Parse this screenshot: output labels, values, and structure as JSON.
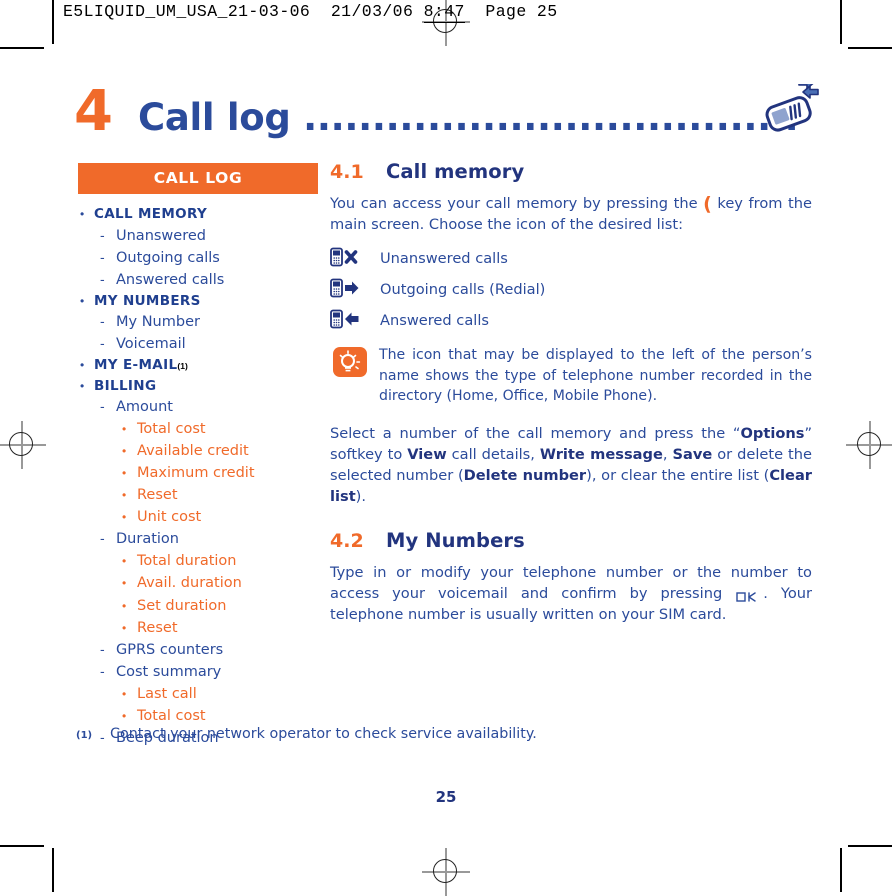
{
  "print_header": {
    "filename": "E5LIQUID_UM_USA_21-03-06",
    "date": "21/03/06",
    "time": "8:47",
    "page_label": "Page 25"
  },
  "chapter": {
    "number": "4",
    "title": "Call log ....................................................",
    "icon": "phone-calllog-icon"
  },
  "sidebar": {
    "header": "CALL LOG",
    "items": [
      {
        "level": 1,
        "label": "CALL MEMORY"
      },
      {
        "level": 2,
        "label": "Unanswered"
      },
      {
        "level": 2,
        "label": "Outgoing calls"
      },
      {
        "level": 2,
        "label": "Answered calls"
      },
      {
        "level": 1,
        "label": "MY NUMBERS"
      },
      {
        "level": 2,
        "label": "My Number"
      },
      {
        "level": 2,
        "label": "Voicemail"
      },
      {
        "level": 1,
        "label": "MY E-MAIL",
        "footnote": "(1)"
      },
      {
        "level": 1,
        "label": "BILLING"
      },
      {
        "level": 2,
        "label": "Amount"
      },
      {
        "level": 3,
        "label": "Total cost"
      },
      {
        "level": 3,
        "label": "Available credit"
      },
      {
        "level": 3,
        "label": "Maximum credit"
      },
      {
        "level": 3,
        "label": "Reset"
      },
      {
        "level": 3,
        "label": "Unit cost"
      },
      {
        "level": 2,
        "label": "Duration"
      },
      {
        "level": 3,
        "label": "Total duration"
      },
      {
        "level": 3,
        "label": "Avail. duration"
      },
      {
        "level": 3,
        "label": "Set duration"
      },
      {
        "level": 3,
        "label": "Reset"
      },
      {
        "level": 2,
        "label": "GPRS counters"
      },
      {
        "level": 2,
        "label": "Cost summary"
      },
      {
        "level": 3,
        "label": "Last call"
      },
      {
        "level": 3,
        "label": "Total cost"
      },
      {
        "level": 2,
        "label": "Beep duration"
      }
    ]
  },
  "sections": [
    {
      "number": "4.1",
      "title": "Call memory",
      "intro_before_key": "You can access your call memory by pressing the ",
      "intro_after_key": " key from the main screen. Choose the icon of the desired list:",
      "call_lists": [
        {
          "icon": "phone-missed-call-icon",
          "label": "Unanswered calls"
        },
        {
          "icon": "phone-outgoing-call-icon",
          "label": "Outgoing calls (Redial)"
        },
        {
          "icon": "phone-incoming-call-icon",
          "label": "Answered calls"
        }
      ],
      "note": {
        "icon": "tip-lightbulb-icon",
        "text": "The icon that may be displayed to the left of the person’s name shows the type of telephone number recorded in the directory (Home, Office, Mobile Phone)."
      },
      "options_para": {
        "p1": "Select a number of the call memory and press the “",
        "b1": "Options",
        "p2": "” softkey to ",
        "b2": "View",
        "p3": " call details, ",
        "b3": "Write message",
        "p4": ", ",
        "b4": "Save",
        "p5": " or delete the selected number (",
        "b5": "Delete number",
        "p6": "), or clear the entire list (",
        "b6": "Clear list",
        "p7": ")."
      }
    },
    {
      "number": "4.2",
      "title": "My Numbers",
      "body_before_key": "Type in or modify your telephone number or the number to access your voicemail and confirm by pressing ",
      "body_after_key": ". Your telephone number is usually written on your SIM card."
    }
  ],
  "footnote": {
    "mark": "(1)",
    "text": "Contact your network operator to check service availability."
  },
  "folio": "25",
  "colors": {
    "orange": "#F06A2A",
    "blue": "#2B4B9B",
    "dark_blue": "#22347E"
  }
}
